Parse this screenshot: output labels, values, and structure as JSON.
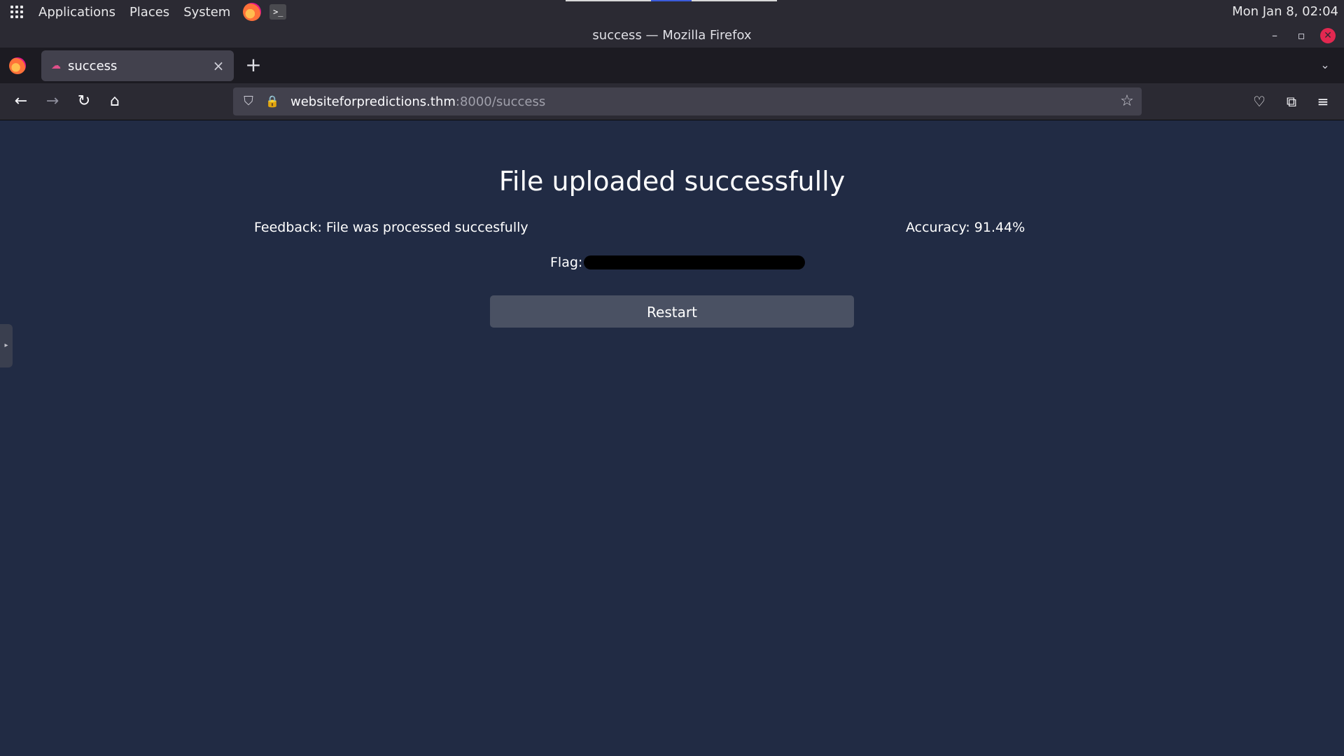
{
  "panel": {
    "menus": [
      "Applications",
      "Places",
      "System"
    ],
    "clock": "Mon Jan 8, 02:04",
    "apps_icon": "apps-grid-icon",
    "launchers": [
      "firefox-icon",
      "terminal-icon"
    ],
    "terminal_glyph": ">_"
  },
  "window": {
    "title": "success — Mozilla Firefox",
    "minimize_glyph": "–",
    "restore_glyph": "▫",
    "close_glyph": "✕"
  },
  "tabs": [
    {
      "label": "success",
      "active": true
    }
  ],
  "tab_glyphs": {
    "close": "×",
    "new": "+",
    "list": "⌄"
  },
  "navbar": {
    "url_host": "websiteforpredictions.thm",
    "url_rest": ":8000/success",
    "icons": [
      "back-icon",
      "forward-icon",
      "reload-icon",
      "home-icon",
      "shield-icon",
      "lock-icon",
      "star-icon",
      "pocket-icon",
      "extensions-icon",
      "hamburger-menu-icon"
    ],
    "glyphs": {
      "back": "←",
      "forward": "→",
      "reload": "↻",
      "home": "⌂",
      "shield": "⛉",
      "lock": "🔒",
      "star": "☆",
      "pocket": "♡",
      "extensions": "⧉",
      "menu": "≡"
    }
  },
  "page": {
    "title": "File uploaded successfully",
    "feedback": "Feedback: File was processed succesfully",
    "accuracy": "Accuracy: 91.44%",
    "flag_label": "Flag:",
    "restart_label": "Restart"
  },
  "colors": {
    "page_bg": "#212b44",
    "chrome_bg": "#2b2a33",
    "tab_active_bg": "#42414d",
    "button_bg": "#4a5163",
    "close_red": "#e22850"
  }
}
